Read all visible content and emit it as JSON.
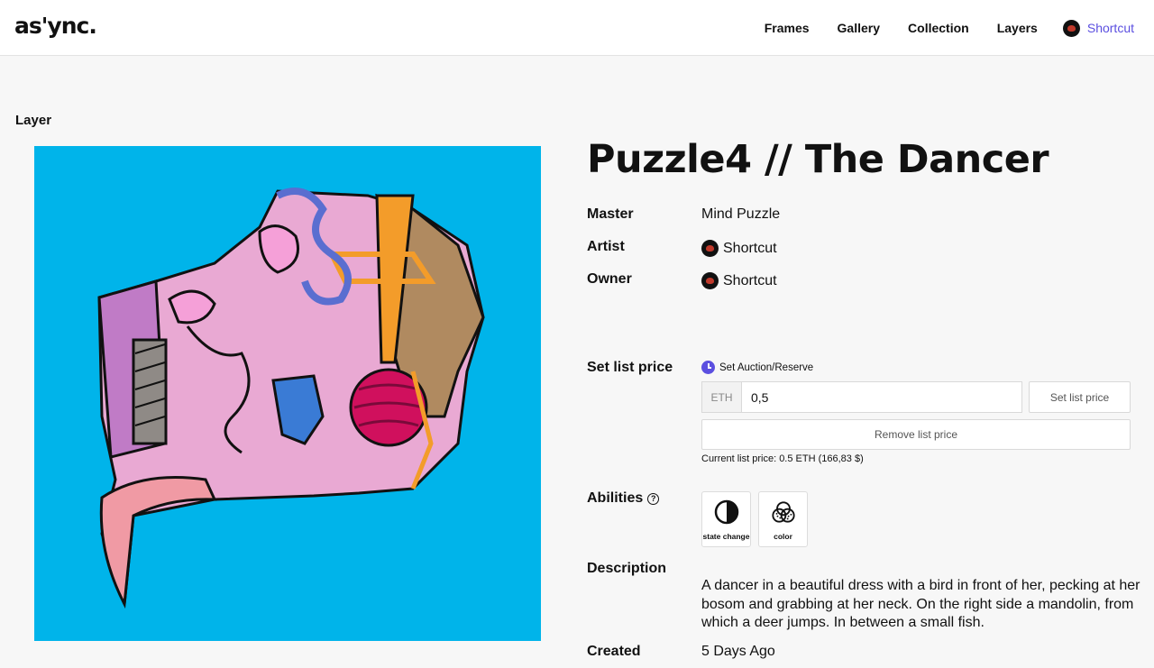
{
  "header": {
    "logo": "as'ync.",
    "nav": [
      "Frames",
      "Gallery",
      "Collection",
      "Layers"
    ],
    "user": {
      "name": "Shortcut",
      "icon": "user-avatar-icon"
    }
  },
  "layer_label": "Layer",
  "artwork": {
    "alt": "Puzzle4 // The Dancer artwork",
    "background": "#00b4ea"
  },
  "details": {
    "title": "Puzzle4 // The Dancer",
    "master_label": "Master",
    "master_value": "Mind Puzzle",
    "artist_label": "Artist",
    "artist_value": "Shortcut",
    "owner_label": "Owner",
    "owner_value": "Shortcut"
  },
  "pricing": {
    "label": "Set list price",
    "auction_link": "Set Auction/Reserve",
    "currency": "ETH",
    "price_value": "0,5",
    "set_button": "Set list price",
    "remove_button": "Remove list price",
    "current": "Current list price: 0.5 ETH (166,83 $)"
  },
  "abilities": {
    "label": "Abilities",
    "help_icon": "?",
    "items": [
      {
        "label": "state change",
        "icon": "state-change-icon"
      },
      {
        "label": "color",
        "icon": "color-icon"
      }
    ]
  },
  "description": {
    "label": "Description",
    "text": "A dancer in a beautiful dress with a bird in front of her, pecking at her bosom and grabbing at her neck. On the right side a mandolin, from which a deer jumps. In between a small fish."
  },
  "created": {
    "label": "Created",
    "value": "5 Days Ago"
  },
  "colors": {
    "accent": "#5b4fe0",
    "artwork_bg": "#00b4ea"
  }
}
